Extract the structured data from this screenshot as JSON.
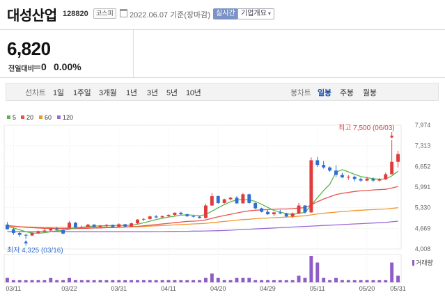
{
  "header": {
    "company_name": "대성산업",
    "stock_code": "128820",
    "market_badge": "코스피",
    "date_text": "2022.06.07 기준(장마감)",
    "realtime_label": "실시간",
    "overview_label": "기업개요"
  },
  "price": {
    "current": "6,820",
    "change_label": "전일대비",
    "change_value": "0",
    "change_rate": "0.00%"
  },
  "toolbar": {
    "line_chart": "선차트",
    "day1": "1일",
    "week1": "1주일",
    "month3": "3개월",
    "year1": "1년",
    "year3": "3년",
    "year5": "5년",
    "year10": "10년",
    "candle_chart": "봉차트",
    "daily": "일봉",
    "weekly": "주봉",
    "monthly": "월봉"
  },
  "colors": {
    "up": "#e03c3c",
    "down": "#2f6fd1",
    "ma5": "#58b84a",
    "ma20": "#e8534e",
    "ma60": "#f0952e",
    "ma120": "#9b6ad6",
    "volume": "#8f5cc6"
  },
  "chart_data": {
    "type": "candlestick",
    "legend": [
      "5",
      "20",
      "60",
      "120"
    ],
    "y_ticks": [
      "7,974",
      "7,313",
      "6,652",
      "5,991",
      "5,330",
      "4,669",
      "4,008"
    ],
    "ylim": [
      4008,
      7974
    ],
    "x_ticks": [
      "03/11",
      "03/22",
      "03/31",
      "04/11",
      "04/20",
      "04/29",
      "05/11",
      "05/20",
      "05/31"
    ],
    "high_annotation": "최고 7,500 (06/03)",
    "low_annotation": "최저 4,325 (03/16)",
    "volume_label": "거래량",
    "candles": [
      [
        4790,
        4870,
        4630,
        4640
      ],
      [
        4640,
        4700,
        4460,
        4520
      ],
      [
        4520,
        4560,
        4400,
        4460
      ],
      [
        4460,
        4500,
        4325,
        4440
      ],
      [
        4440,
        4540,
        4420,
        4520
      ],
      [
        4520,
        4600,
        4490,
        4580
      ],
      [
        4580,
        4650,
        4540,
        4600
      ],
      [
        4600,
        4680,
        4570,
        4660
      ],
      [
        4660,
        4720,
        4600,
        4620
      ],
      [
        4620,
        4650,
        4480,
        4500
      ],
      [
        4680,
        4900,
        4660,
        4850
      ],
      [
        4850,
        4870,
        4690,
        4700
      ],
      [
        4700,
        4760,
        4680,
        4720
      ],
      [
        4720,
        4810,
        4700,
        4790
      ],
      [
        4790,
        4800,
        4700,
        4720
      ],
      [
        4720,
        4780,
        4700,
        4750
      ],
      [
        4750,
        4800,
        4700,
        4780
      ],
      [
        4780,
        4790,
        4700,
        4720
      ],
      [
        4720,
        4830,
        4700,
        4800
      ],
      [
        4800,
        4810,
        4720,
        4730
      ],
      [
        4730,
        4850,
        4720,
        4830
      ],
      [
        4830,
        4960,
        4810,
        4950
      ],
      [
        4950,
        5000,
        4900,
        4970
      ],
      [
        4970,
        5080,
        4950,
        5050
      ],
      [
        5050,
        5100,
        4990,
        5020
      ],
      [
        5020,
        5080,
        5000,
        5060
      ],
      [
        5060,
        5120,
        5030,
        5100
      ],
      [
        5100,
        5180,
        5060,
        5170
      ],
      [
        5170,
        5200,
        5100,
        5120
      ],
      [
        5120,
        5140,
        5030,
        5060
      ],
      [
        5060,
        5090,
        5020,
        5040
      ],
      [
        5040,
        5060,
        4990,
        5000
      ],
      [
        5000,
        5460,
        4980,
        5400
      ],
      [
        5400,
        5800,
        5390,
        5700
      ],
      [
        5700,
        5720,
        5450,
        5480
      ],
      [
        5480,
        5620,
        5460,
        5600
      ],
      [
        5600,
        5680,
        5560,
        5650
      ],
      [
        5650,
        5700,
        5450,
        5470
      ],
      [
        5470,
        5800,
        5460,
        5760
      ],
      [
        5760,
        5780,
        5460,
        5480
      ],
      [
        5480,
        5500,
        5280,
        5310
      ],
      [
        5310,
        5330,
        5180,
        5200
      ],
      [
        5200,
        5260,
        5100,
        5120
      ],
      [
        5120,
        5200,
        5060,
        5180
      ],
      [
        5180,
        5260,
        5120,
        5150
      ],
      [
        5150,
        5170,
        5030,
        5050
      ],
      [
        5050,
        5180,
        5000,
        5150
      ],
      [
        5150,
        5480,
        5120,
        5400
      ],
      [
        5400,
        5410,
        5140,
        5180
      ],
      [
        5180,
        6940,
        5170,
        6850
      ],
      [
        6850,
        6960,
        6640,
        6700
      ],
      [
        6700,
        6830,
        6580,
        6620
      ],
      [
        6620,
        6650,
        6480,
        6520
      ],
      [
        6520,
        6700,
        6300,
        6380
      ],
      [
        6380,
        6450,
        6280,
        6300
      ],
      [
        6300,
        6380,
        6220,
        6320
      ],
      [
        6320,
        6360,
        6180,
        6250
      ],
      [
        6250,
        6300,
        6160,
        6200
      ],
      [
        6200,
        6320,
        6180,
        6260
      ],
      [
        6260,
        6300,
        6160,
        6200
      ],
      [
        6200,
        6280,
        6160,
        6240
      ],
      [
        6240,
        6450,
        6220,
        6400
      ],
      [
        6400,
        7500,
        6560,
        6800
      ],
      [
        6800,
        7150,
        6620,
        7050
      ]
    ],
    "ma5": [
      4720,
      4680,
      4620,
      4560,
      4520,
      4510,
      4530,
      4560,
      4590,
      4600,
      4640,
      4680,
      4700,
      4730,
      4740,
      4750,
      4750,
      4760,
      4760,
      4760,
      4770,
      4800,
      4850,
      4900,
      4950,
      4990,
      5030,
      5060,
      5090,
      5100,
      5090,
      5070,
      5110,
      5220,
      5330,
      5430,
      5520,
      5580,
      5590,
      5580,
      5530,
      5440,
      5340,
      5240,
      5190,
      5140,
      5110,
      5150,
      5180,
      5410,
      5650,
      5880,
      6080,
      6470,
      6550,
      6480,
      6400,
      6330,
      6290,
      6260,
      6240,
      6250,
      6350,
      6500
    ],
    "ma20": [
      4760,
      4740,
      4720,
      4700,
      4690,
      4680,
      4670,
      4670,
      4660,
      4660,
      4660,
      4660,
      4670,
      4670,
      4680,
      4680,
      4690,
      4690,
      4700,
      4710,
      4720,
      4730,
      4750,
      4770,
      4790,
      4810,
      4830,
      4850,
      4870,
      4890,
      4900,
      4910,
      4940,
      4990,
      5040,
      5080,
      5120,
      5160,
      5200,
      5230,
      5250,
      5260,
      5270,
      5280,
      5290,
      5290,
      5300,
      5320,
      5330,
      5420,
      5520,
      5610,
      5680,
      5750,
      5790,
      5820,
      5850,
      5870,
      5880,
      5900,
      5910,
      5920,
      5960,
      6010
    ],
    "ma60": [
      4740,
      4730,
      4720,
      4715,
      4710,
      4705,
      4700,
      4700,
      4700,
      4700,
      4700,
      4700,
      4700,
      4700,
      4700,
      4705,
      4705,
      4710,
      4710,
      4715,
      4720,
      4725,
      4730,
      4740,
      4750,
      4760,
      4770,
      4780,
      4790,
      4800,
      4810,
      4820,
      4830,
      4850,
      4870,
      4890,
      4910,
      4930,
      4950,
      4960,
      4980,
      4990,
      5000,
      5010,
      5020,
      5030,
      5040,
      5060,
      5070,
      5100,
      5130,
      5150,
      5170,
      5190,
      5210,
      5220,
      5240,
      5250,
      5260,
      5270,
      5280,
      5290,
      5310,
      5330
    ],
    "ma120": [
      4560,
      4560,
      4560,
      4560,
      4560,
      4560,
      4560,
      4560,
      4560,
      4560,
      4560,
      4560,
      4560,
      4560,
      4560,
      4560,
      4560,
      4560,
      4560,
      4560,
      4560,
      4560,
      4560,
      4560,
      4565,
      4565,
      4570,
      4570,
      4575,
      4575,
      4580,
      4580,
      4585,
      4590,
      4595,
      4600,
      4610,
      4620,
      4630,
      4640,
      4650,
      4660,
      4670,
      4680,
      4690,
      4700,
      4710,
      4720,
      4730,
      4740,
      4750,
      4760,
      4770,
      4780,
      4790,
      4800,
      4810,
      4820,
      4830,
      4840,
      4850,
      4860,
      4880,
      4900
    ],
    "volume": [
      2,
      1,
      1,
      1,
      1,
      1,
      1,
      2,
      1,
      1,
      2,
      1,
      1,
      1,
      1,
      1,
      1,
      1,
      1,
      1,
      1,
      1,
      1,
      1,
      1,
      1,
      1,
      1,
      1,
      1,
      1,
      1,
      2,
      4,
      2,
      1,
      1,
      2,
      2,
      2,
      1,
      1,
      1,
      1,
      1,
      1,
      1,
      3,
      2,
      12,
      9,
      2,
      1,
      2,
      1,
      1,
      1,
      1,
      1,
      1,
      1,
      1,
      9,
      3
    ]
  }
}
